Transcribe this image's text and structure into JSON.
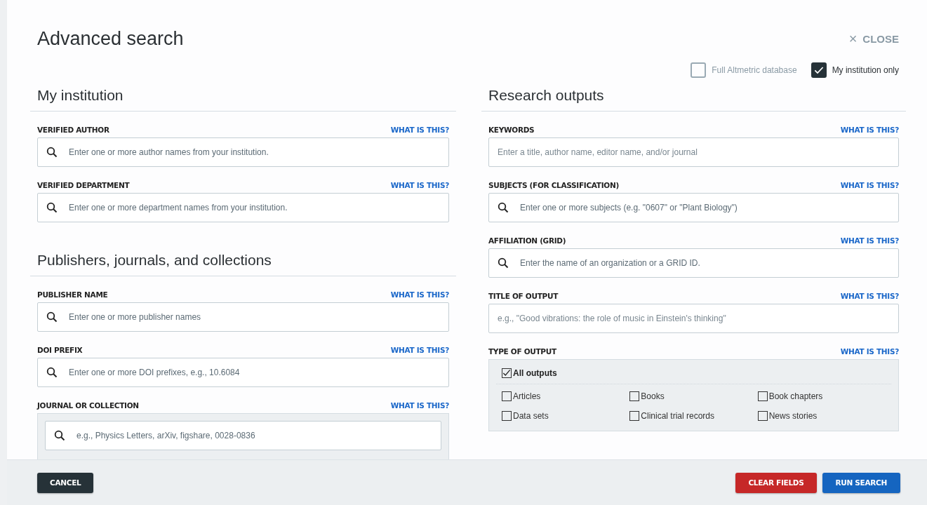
{
  "title": "Advanced search",
  "close": {
    "icon": "×",
    "label": "CLOSE"
  },
  "scope": [
    {
      "label": "Full Altmetric database",
      "checked": false
    },
    {
      "label": "My institution only",
      "checked": true
    }
  ],
  "left": [
    {
      "heading": "My institution",
      "fields": [
        {
          "label": "VERIFIED AUTHOR",
          "help": "WHAT IS THIS?",
          "kind": "search",
          "placeholder": "Enter one or more author names from your institution."
        },
        {
          "label": "VERIFIED DEPARTMENT",
          "help": "WHAT IS THIS?",
          "kind": "search",
          "placeholder": "Enter one or more department names from your institution."
        }
      ]
    },
    {
      "heading": "Publishers, journals, and collections",
      "fields": [
        {
          "label": "PUBLISHER NAME",
          "help": "WHAT IS THIS?",
          "kind": "search",
          "placeholder": "Enter one or more publisher names"
        },
        {
          "label": "DOI PREFIX",
          "help": "WHAT IS THIS?",
          "kind": "search",
          "placeholder": "Enter one or more DOI prefixes, e.g., 10.6084"
        },
        {
          "label": "JOURNAL OR COLLECTION",
          "help": "WHAT IS THIS?",
          "kind": "boxed",
          "placeholder": "e.g., Physics Letters, arXiv, figshare, 0028-0836"
        }
      ]
    }
  ],
  "right": {
    "heading": "Research outputs",
    "fields": [
      {
        "label": "KEYWORDS",
        "help": "WHAT IS THIS?",
        "kind": "plain",
        "placeholder": "Enter a title, author name, editor name, and/or journal"
      },
      {
        "label": "SUBJECTS (FOR CLASSIFICATION)",
        "help": "WHAT IS THIS?",
        "kind": "search",
        "placeholder": "Enter one or more subjects (e.g. \"0607\" or \"Plant Biology\")"
      },
      {
        "label": "AFFILIATION (GRID)",
        "help": "WHAT IS THIS?",
        "kind": "search",
        "placeholder": "Enter the name of an organization or a GRID ID."
      },
      {
        "label": "TITLE OF OUTPUT",
        "help": "WHAT IS THIS?",
        "kind": "plain",
        "placeholder": "e.g., \"Good vibrations: the role of music in Einstein's thinking\""
      }
    ],
    "output_type": {
      "label": "TYPE OF OUTPUT",
      "help": "WHAT IS THIS?",
      "all": {
        "label": "All outputs",
        "checked": true
      },
      "options": [
        {
          "label": "Articles",
          "checked": false
        },
        {
          "label": "Books",
          "checked": false
        },
        {
          "label": "Book chapters",
          "checked": false
        },
        {
          "label": "Data sets",
          "checked": false
        },
        {
          "label": "Clinical trial records",
          "checked": false
        },
        {
          "label": "News stories",
          "checked": false
        }
      ]
    }
  },
  "footer": {
    "cancel": "CANCEL",
    "clear": "CLEAR FIELDS",
    "run": "RUN SEARCH"
  }
}
